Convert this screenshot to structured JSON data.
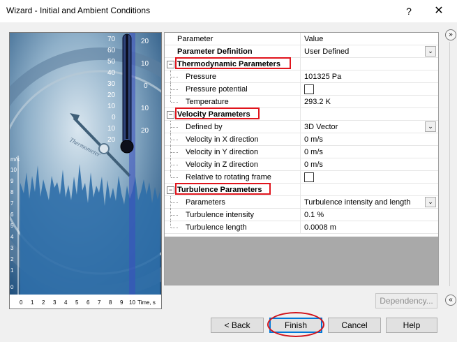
{
  "window": {
    "title": "Wizard - Initial and Ambient Conditions",
    "help_glyph": "?",
    "close_glyph": "✕"
  },
  "image_panel": {
    "thermometer_ticks": [
      "70",
      "60",
      "50",
      "40",
      "30",
      "20",
      "10",
      "0",
      "10",
      "20"
    ],
    "thermometer_right": [
      "20",
      "10",
      "0",
      "10",
      "20"
    ],
    "ms_axis": [
      "m/s",
      "10",
      "9",
      "8",
      "7",
      "6",
      "5",
      "4",
      "3",
      "2",
      "1",
      "0"
    ],
    "time_axis": [
      "0",
      "1",
      "2",
      "3",
      "4",
      "5",
      "6",
      "7",
      "8",
      "9",
      "10",
      "Time, s"
    ],
    "dial_text": "Thermometer"
  },
  "grid": {
    "header": {
      "name": "Parameter",
      "value": "Value"
    },
    "rows": [
      {
        "name": "Parameter Definition",
        "value": "User Defined"
      },
      {
        "name": "Thermodynamic Parameters",
        "value": ""
      },
      {
        "name": "Pressure",
        "value": "101325 Pa"
      },
      {
        "name": "Pressure potential",
        "value": ""
      },
      {
        "name": "Temperature",
        "value": "293.2 K"
      },
      {
        "name": "Velocity Parameters",
        "value": ""
      },
      {
        "name": "Defined by",
        "value": "3D Vector"
      },
      {
        "name": "Velocity in X direction",
        "value": "0 m/s"
      },
      {
        "name": "Velocity in Y direction",
        "value": "0 m/s"
      },
      {
        "name": "Velocity in Z direction",
        "value": "0 m/s"
      },
      {
        "name": "Relative to rotating frame",
        "value": ""
      },
      {
        "name": "Turbulence Parameters",
        "value": ""
      },
      {
        "name": "Parameters",
        "value": "Turbulence intensity and length"
      },
      {
        "name": "Turbulence intensity",
        "value": "0.1 %"
      },
      {
        "name": "Turbulence length",
        "value": "0.0008 m"
      }
    ],
    "collapse_glyph": "−",
    "dropdown_glyph": "⌄"
  },
  "buttons": {
    "dependency": "Dependency...",
    "back": "< Back",
    "finish": "Finish",
    "cancel": "Cancel",
    "help": "Help"
  },
  "scroll": {
    "top_glyph": "»",
    "bottom_glyph": "«"
  },
  "colors": {
    "highlight": "#e0141c",
    "default_button": "#0078d7"
  }
}
